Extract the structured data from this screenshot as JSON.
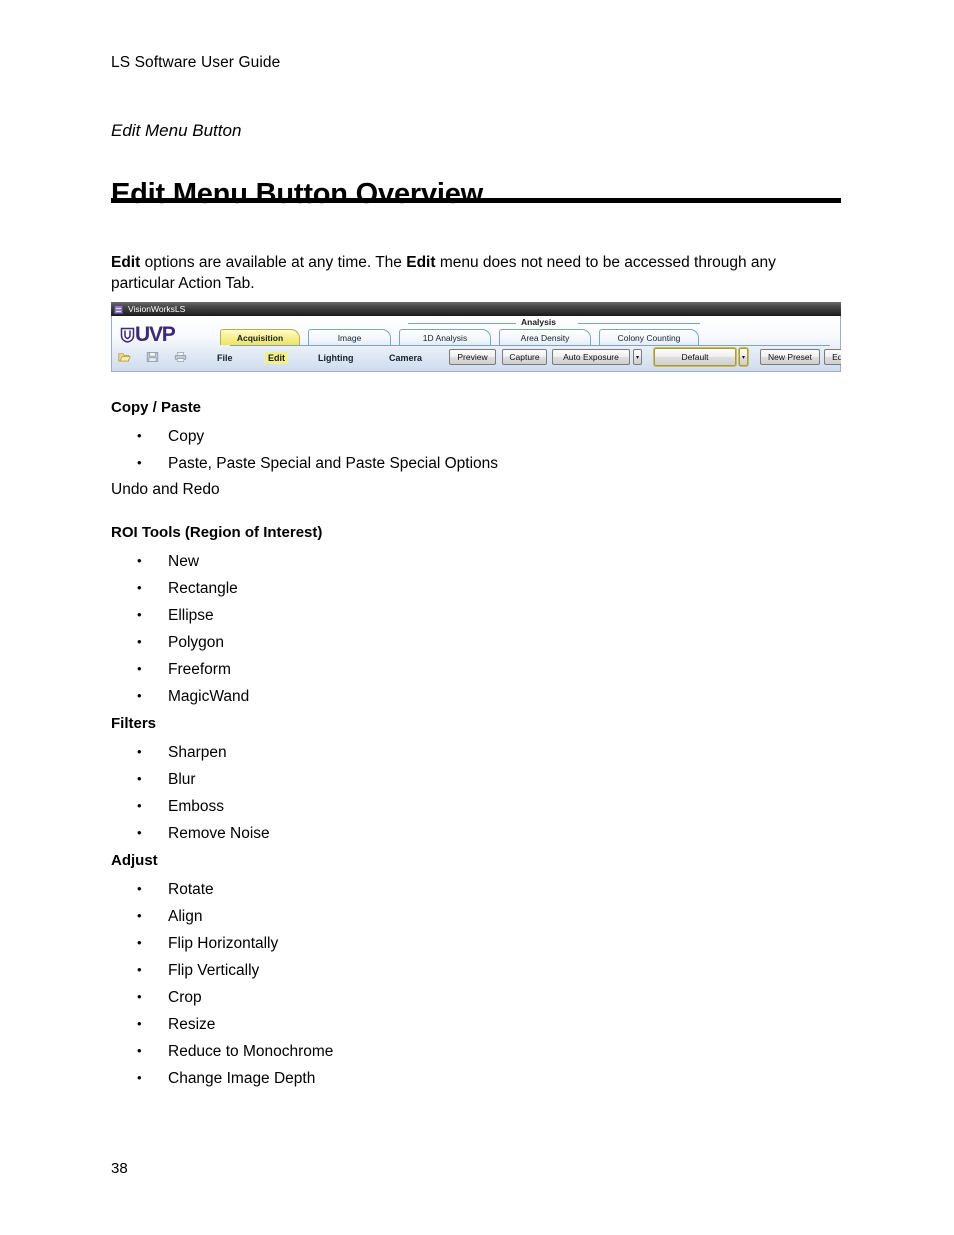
{
  "document": {
    "running_header": "LS Software User Guide",
    "chapter_label": "Edit Menu Button",
    "page_title": "Edit Menu Button Overview",
    "page_number": "38",
    "intro": {
      "bold_1": "Edit",
      "text_1": " options are available at any time. The ",
      "bold_2": "Edit",
      "text_2": " menu does not need to be accessed through any particular Action Tab."
    }
  },
  "app_screenshot": {
    "titlebar": {
      "app_name": "VisionWorksLS",
      "icon": "app-window-icon"
    },
    "logo": {
      "wordmark": "UVP",
      "crest": "uvp-crest-icon",
      "color": "#3d2a78"
    },
    "group_label": "Analysis",
    "tabs": [
      {
        "label": "Acquisition",
        "active": true
      },
      {
        "label": "Image",
        "active": false
      },
      {
        "label": "1D Analysis",
        "active": false
      },
      {
        "label": "Area Density",
        "active": false
      },
      {
        "label": "Colony Counting",
        "active": false
      }
    ],
    "tool_icons": [
      {
        "name": "open-folder-icon",
        "color": "#f5dc7a"
      },
      {
        "name": "save-floppy-icon",
        "color": "#b9c2cc"
      },
      {
        "name": "print-icon",
        "color": "#b9c2cc"
      }
    ],
    "menus": [
      {
        "label": "File",
        "highlighted": false
      },
      {
        "label": "Edit",
        "highlighted": true
      },
      {
        "label": "Lighting",
        "highlighted": false
      },
      {
        "label": "Camera",
        "highlighted": false
      }
    ],
    "buttons": [
      {
        "label": "Preview",
        "focused": false
      },
      {
        "label": "Capture",
        "focused": false
      },
      {
        "label": "Auto Exposure",
        "focused": false
      },
      {
        "label": "Default",
        "focused": true
      },
      {
        "label": "New Preset",
        "focused": false
      },
      {
        "label": "Edit Presets",
        "focused": false
      }
    ],
    "dropdown_glyph": "▾",
    "highlight_color": "#f5ef86"
  },
  "sections": [
    {
      "heading": "Copy / Paste",
      "items": [
        "Copy",
        "Paste, Paste Special and Paste Special Options"
      ],
      "trailing_text": "Undo and Redo"
    },
    {
      "heading": "ROI Tools (Region of Interest)",
      "items": [
        "New",
        "Rectangle",
        "Ellipse",
        "Polygon",
        "Freeform",
        "MagicWand"
      ],
      "trailing_text": ""
    },
    {
      "heading": "Filters",
      "items": [
        "Sharpen",
        "Blur",
        "Emboss",
        "Remove Noise"
      ],
      "trailing_text": ""
    },
    {
      "heading": "Adjust",
      "items": [
        "Rotate",
        "Align",
        "Flip Horizontally",
        "Flip Vertically",
        "Crop",
        "Resize",
        "Reduce to Monochrome",
        "Change Image Depth"
      ],
      "trailing_text": ""
    }
  ]
}
